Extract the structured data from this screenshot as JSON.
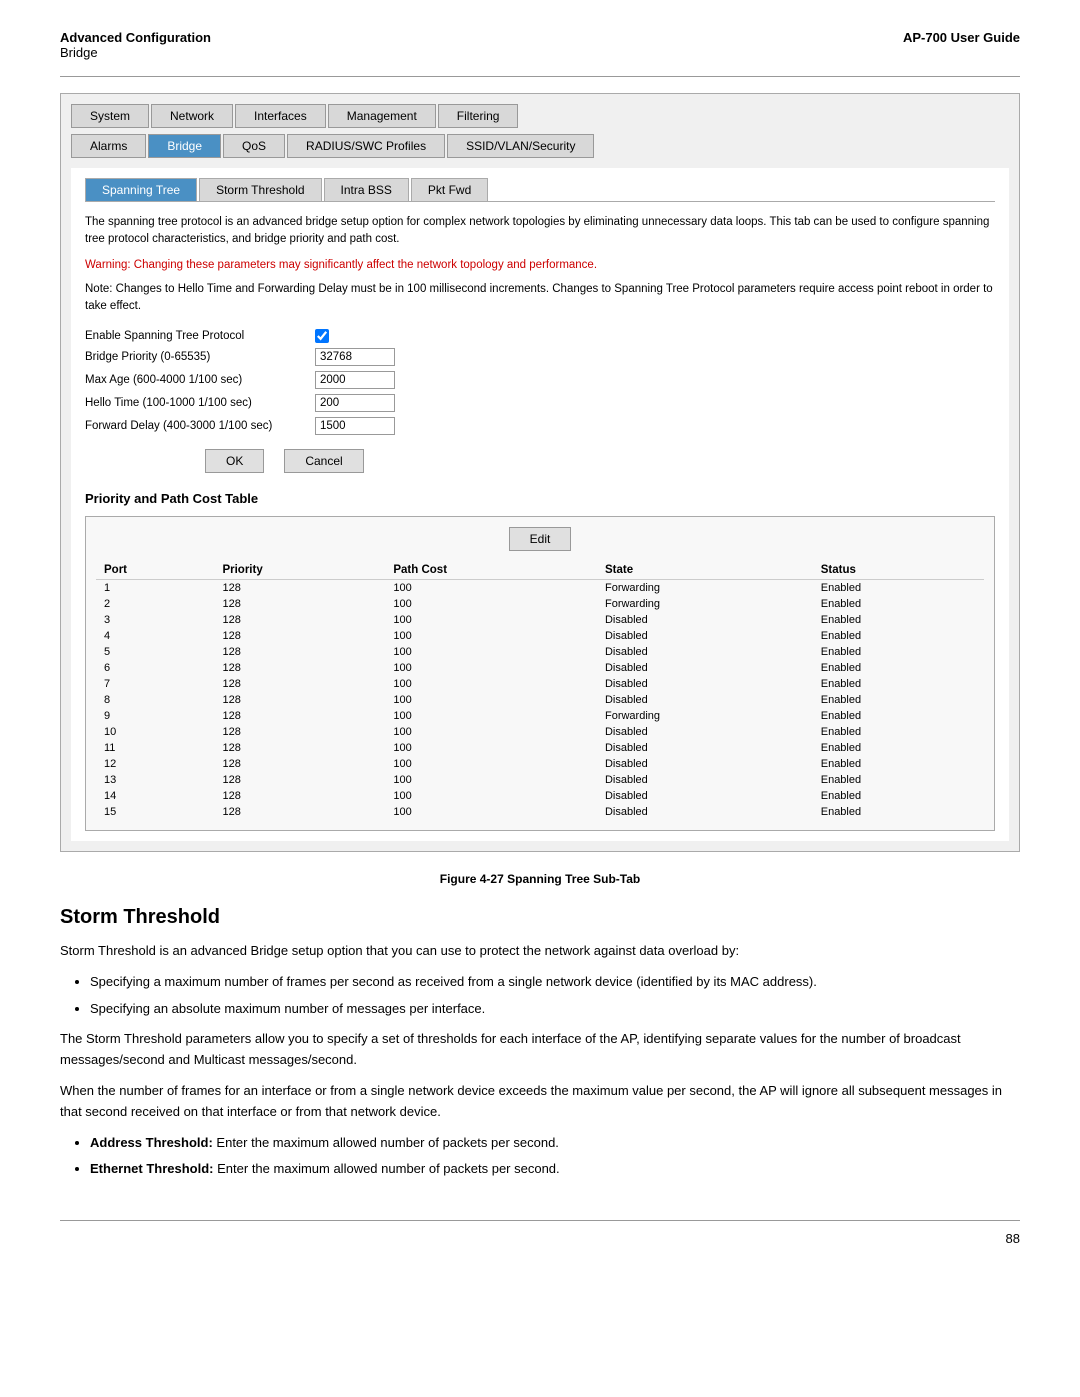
{
  "header": {
    "left_label": "Advanced Configuration",
    "sub_label": "Bridge",
    "right_label": "AP-700 User Guide"
  },
  "tabs_row1": [
    {
      "label": "System",
      "active": false
    },
    {
      "label": "Network",
      "active": false
    },
    {
      "label": "Interfaces",
      "active": false
    },
    {
      "label": "Management",
      "active": false
    },
    {
      "label": "Filtering",
      "active": false
    }
  ],
  "tabs_row2": [
    {
      "label": "Alarms",
      "active": false
    },
    {
      "label": "Bridge",
      "active": true
    },
    {
      "label": "QoS",
      "active": false
    },
    {
      "label": "RADIUS/SWC Profiles",
      "active": false
    },
    {
      "label": "SSID/VLAN/Security",
      "active": false
    }
  ],
  "sub_tabs": [
    {
      "label": "Spanning Tree",
      "active": true
    },
    {
      "label": "Storm Threshold",
      "active": false
    },
    {
      "label": "Intra BSS",
      "active": false
    },
    {
      "label": "Pkt Fwd",
      "active": false
    }
  ],
  "description": "The spanning tree protocol is an advanced bridge setup option for complex network topologies by eliminating unnecessary data loops. This tab can be used to configure spanning tree protocol characteristics, and bridge priority and path cost.",
  "warning": "Warning: Changing these parameters may significantly affect the network topology and performance.",
  "note": "Note: Changes to Hello Time and Forwarding Delay must be in 100 millisecond increments. Changes to Spanning Tree Protocol parameters require access point reboot in order to take effect.",
  "form_fields": [
    {
      "label": "Enable Spanning Tree Protocol",
      "type": "checkbox",
      "value": true
    },
    {
      "label": "Bridge Priority (0-65535)",
      "type": "text",
      "value": "32768"
    },
    {
      "label": "Max Age (600-4000 1/100 sec)",
      "type": "text",
      "value": "2000"
    },
    {
      "label": "Hello Time (100-1000 1/100 sec)",
      "type": "text",
      "value": "200"
    },
    {
      "label": "Forward Delay (400-3000 1/100 sec)",
      "type": "text",
      "value": "1500"
    }
  ],
  "buttons": {
    "ok_label": "OK",
    "cancel_label": "Cancel"
  },
  "priority_section": {
    "title": "Priority and Path Cost Table",
    "edit_button": "Edit",
    "columns": [
      "Port",
      "Priority",
      "Path Cost",
      "State",
      "Status"
    ],
    "rows": [
      {
        "port": "1",
        "priority": "128",
        "path_cost": "100",
        "state": "Forwarding",
        "status": "Enabled"
      },
      {
        "port": "2",
        "priority": "128",
        "path_cost": "100",
        "state": "Forwarding",
        "status": "Enabled"
      },
      {
        "port": "3",
        "priority": "128",
        "path_cost": "100",
        "state": "Disabled",
        "status": "Enabled"
      },
      {
        "port": "4",
        "priority": "128",
        "path_cost": "100",
        "state": "Disabled",
        "status": "Enabled"
      },
      {
        "port": "5",
        "priority": "128",
        "path_cost": "100",
        "state": "Disabled",
        "status": "Enabled"
      },
      {
        "port": "6",
        "priority": "128",
        "path_cost": "100",
        "state": "Disabled",
        "status": "Enabled"
      },
      {
        "port": "7",
        "priority": "128",
        "path_cost": "100",
        "state": "Disabled",
        "status": "Enabled"
      },
      {
        "port": "8",
        "priority": "128",
        "path_cost": "100",
        "state": "Disabled",
        "status": "Enabled"
      },
      {
        "port": "9",
        "priority": "128",
        "path_cost": "100",
        "state": "Forwarding",
        "status": "Enabled"
      },
      {
        "port": "10",
        "priority": "128",
        "path_cost": "100",
        "state": "Disabled",
        "status": "Enabled"
      },
      {
        "port": "11",
        "priority": "128",
        "path_cost": "100",
        "state": "Disabled",
        "status": "Enabled"
      },
      {
        "port": "12",
        "priority": "128",
        "path_cost": "100",
        "state": "Disabled",
        "status": "Enabled"
      },
      {
        "port": "13",
        "priority": "128",
        "path_cost": "100",
        "state": "Disabled",
        "status": "Enabled"
      },
      {
        "port": "14",
        "priority": "128",
        "path_cost": "100",
        "state": "Disabled",
        "status": "Enabled"
      },
      {
        "port": "15",
        "priority": "128",
        "path_cost": "100",
        "state": "Disabled",
        "status": "Enabled"
      }
    ]
  },
  "figure_caption": "Figure 4-27 Spanning Tree Sub-Tab",
  "storm_threshold": {
    "title": "Storm Threshold",
    "intro": "Storm Threshold is an advanced Bridge setup option that you can use to protect the network against data overload by:",
    "bullets": [
      "Specifying a maximum number of frames per second as received from a single network device (identified by its MAC address).",
      "Specifying an absolute maximum number of messages per interface."
    ],
    "para1": "The Storm Threshold parameters allow you to specify a set of thresholds for each interface of the AP, identifying separate values for the number of broadcast messages/second and Multicast messages/second.",
    "para2": "When the number of frames for an interface or from a single network device exceeds the maximum value per second, the AP will ignore all subsequent messages in that second received on that interface or from that network device.",
    "bullets2": [
      {
        "bold": "Address Threshold:",
        "rest": " Enter the maximum allowed number of packets per second."
      },
      {
        "bold": "Ethernet Threshold:",
        "rest": " Enter the maximum allowed number of packets per second."
      }
    ]
  },
  "page_number": "88"
}
